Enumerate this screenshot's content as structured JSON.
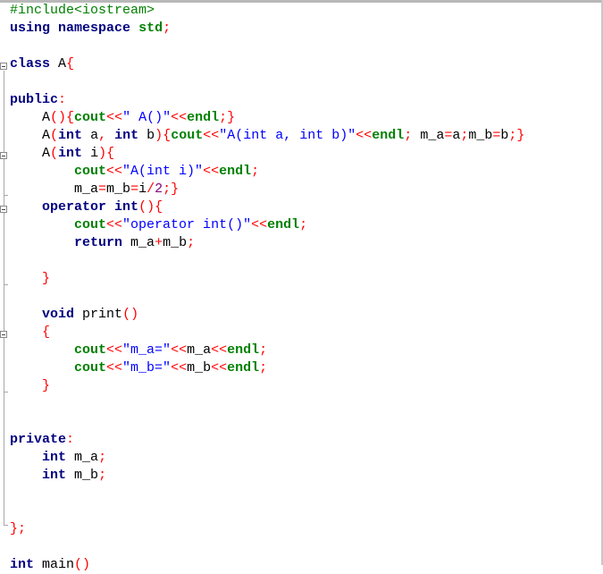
{
  "editor": {
    "lines": [
      [
        [
          "preproc",
          "#include<iostream>"
        ]
      ],
      [
        [
          "kw",
          "using"
        ],
        [
          "plain",
          " "
        ],
        [
          "kw",
          "namespace"
        ],
        [
          "plain",
          " "
        ],
        [
          "stream",
          "std"
        ],
        [
          "op",
          ";"
        ]
      ],
      [],
      [
        [
          "kw",
          "class"
        ],
        [
          "plain",
          " "
        ],
        [
          "id",
          "A"
        ],
        [
          "op",
          "{"
        ]
      ],
      [],
      [
        [
          "kw",
          "public"
        ],
        [
          "op",
          ":"
        ]
      ],
      [
        [
          "plain",
          "    "
        ],
        [
          "id",
          "A"
        ],
        [
          "op",
          "(){"
        ],
        [
          "stream",
          "cout"
        ],
        [
          "op",
          "<<"
        ],
        [
          "str",
          "\" A()\""
        ],
        [
          "op",
          "<<"
        ],
        [
          "stream",
          "endl"
        ],
        [
          "op",
          ";}"
        ]
      ],
      [
        [
          "plain",
          "    "
        ],
        [
          "id",
          "A"
        ],
        [
          "op",
          "("
        ],
        [
          "kw",
          "int"
        ],
        [
          "plain",
          " "
        ],
        [
          "id",
          "a"
        ],
        [
          "op",
          ","
        ],
        [
          "plain",
          " "
        ],
        [
          "kw",
          "int"
        ],
        [
          "plain",
          " "
        ],
        [
          "id",
          "b"
        ],
        [
          "op",
          "){"
        ],
        [
          "stream",
          "cout"
        ],
        [
          "op",
          "<<"
        ],
        [
          "str",
          "\"A(int a, int b)\""
        ],
        [
          "op",
          "<<"
        ],
        [
          "stream",
          "endl"
        ],
        [
          "op",
          ";"
        ],
        [
          "plain",
          " "
        ],
        [
          "id",
          "m_a"
        ],
        [
          "op",
          "="
        ],
        [
          "id",
          "a"
        ],
        [
          "op",
          ";"
        ],
        [
          "id",
          "m_b"
        ],
        [
          "op",
          "="
        ],
        [
          "id",
          "b"
        ],
        [
          "op",
          ";}"
        ]
      ],
      [
        [
          "plain",
          "    "
        ],
        [
          "id",
          "A"
        ],
        [
          "op",
          "("
        ],
        [
          "kw",
          "int"
        ],
        [
          "plain",
          " "
        ],
        [
          "id",
          "i"
        ],
        [
          "op",
          "){"
        ]
      ],
      [
        [
          "plain",
          "        "
        ],
        [
          "stream",
          "cout"
        ],
        [
          "op",
          "<<"
        ],
        [
          "str",
          "\"A(int i)\""
        ],
        [
          "op",
          "<<"
        ],
        [
          "stream",
          "endl"
        ],
        [
          "op",
          ";"
        ]
      ],
      [
        [
          "plain",
          "        "
        ],
        [
          "id",
          "m_a"
        ],
        [
          "op",
          "="
        ],
        [
          "id",
          "m_b"
        ],
        [
          "op",
          "="
        ],
        [
          "id",
          "i"
        ],
        [
          "op",
          "/"
        ],
        [
          "num",
          "2"
        ],
        [
          "op",
          ";}"
        ]
      ],
      [
        [
          "plain",
          "    "
        ],
        [
          "kw",
          "operator"
        ],
        [
          "plain",
          " "
        ],
        [
          "kw",
          "int"
        ],
        [
          "op",
          "(){"
        ]
      ],
      [
        [
          "plain",
          "        "
        ],
        [
          "stream",
          "cout"
        ],
        [
          "op",
          "<<"
        ],
        [
          "str",
          "\"operator int()\""
        ],
        [
          "op",
          "<<"
        ],
        [
          "stream",
          "endl"
        ],
        [
          "op",
          ";"
        ]
      ],
      [
        [
          "plain",
          "        "
        ],
        [
          "kw",
          "return"
        ],
        [
          "plain",
          " "
        ],
        [
          "id",
          "m_a"
        ],
        [
          "op",
          "+"
        ],
        [
          "id",
          "m_b"
        ],
        [
          "op",
          ";"
        ]
      ],
      [],
      [
        [
          "plain",
          "    "
        ],
        [
          "op",
          "}"
        ]
      ],
      [],
      [
        [
          "plain",
          "    "
        ],
        [
          "kw",
          "void"
        ],
        [
          "plain",
          " "
        ],
        [
          "id",
          "print"
        ],
        [
          "op",
          "()"
        ]
      ],
      [
        [
          "plain",
          "    "
        ],
        [
          "op",
          "{"
        ]
      ],
      [
        [
          "plain",
          "        "
        ],
        [
          "stream",
          "cout"
        ],
        [
          "op",
          "<<"
        ],
        [
          "str",
          "\"m_a=\""
        ],
        [
          "op",
          "<<"
        ],
        [
          "id",
          "m_a"
        ],
        [
          "op",
          "<<"
        ],
        [
          "stream",
          "endl"
        ],
        [
          "op",
          ";"
        ]
      ],
      [
        [
          "plain",
          "        "
        ],
        [
          "stream",
          "cout"
        ],
        [
          "op",
          "<<"
        ],
        [
          "str",
          "\"m_b=\""
        ],
        [
          "op",
          "<<"
        ],
        [
          "id",
          "m_b"
        ],
        [
          "op",
          "<<"
        ],
        [
          "stream",
          "endl"
        ],
        [
          "op",
          ";"
        ]
      ],
      [
        [
          "plain",
          "    "
        ],
        [
          "op",
          "}"
        ]
      ],
      [],
      [],
      [
        [
          "kw",
          "private"
        ],
        [
          "op",
          ":"
        ]
      ],
      [
        [
          "plain",
          "    "
        ],
        [
          "kw",
          "int"
        ],
        [
          "plain",
          " "
        ],
        [
          "id",
          "m_a"
        ],
        [
          "op",
          ";"
        ]
      ],
      [
        [
          "plain",
          "    "
        ],
        [
          "kw",
          "int"
        ],
        [
          "plain",
          " "
        ],
        [
          "id",
          "m_b"
        ],
        [
          "op",
          ";"
        ]
      ],
      [],
      [],
      [
        [
          "op",
          "};"
        ]
      ],
      [],
      [
        [
          "kw",
          "int"
        ],
        [
          "plain",
          " "
        ],
        [
          "id",
          "main"
        ],
        [
          "op",
          "()"
        ]
      ]
    ]
  },
  "colors": {
    "preprocessor": "#008000",
    "keyword": "#000080",
    "stream": "#008000",
    "string": "#0000ff",
    "operator": "#ff0000",
    "number": "#800080"
  }
}
